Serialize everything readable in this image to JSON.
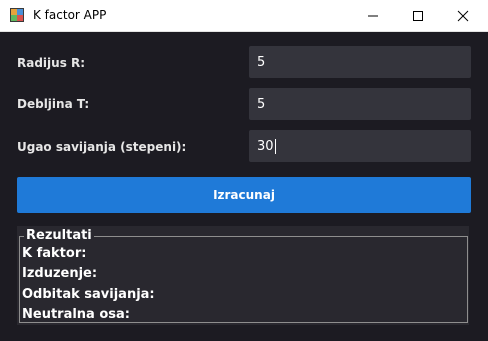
{
  "window": {
    "title": "K factor APP",
    "icon": "app-icon",
    "controls": [
      "minimize-icon",
      "maximize-icon",
      "close-icon"
    ]
  },
  "form": {
    "radius": {
      "label": "Radijus R:",
      "value": "5"
    },
    "thickness": {
      "label": "Debljina T:",
      "value": "5"
    },
    "angle": {
      "label": "Ugao savijanja (stepeni):",
      "value": "30"
    }
  },
  "calculate_label": "Izracunaj",
  "results": {
    "legend": "Rezultati",
    "k_factor": "K faktor:",
    "elongation": "Izduzenje:",
    "bend_deduction": "Odbitak savijanja:",
    "neutral_axis": "Neutralna osa:"
  },
  "colors": {
    "background": "#1c1b22",
    "field": "#34343c",
    "accent": "#1f7ad8",
    "results_panel": "#29282f"
  }
}
